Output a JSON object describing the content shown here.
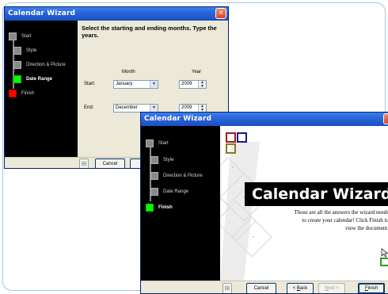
{
  "back_window": {
    "title": "Calendar Wizard",
    "close_icon": "×",
    "nav": [
      {
        "label": "Start"
      },
      {
        "label": "Style"
      },
      {
        "label": "Direction & Picture"
      },
      {
        "label": "Date Range"
      },
      {
        "label": "Finish"
      }
    ],
    "instruction": "Select the starting and ending months.  Type the years.",
    "month_header": "Month",
    "year_header": "Year",
    "start_label": "Start:",
    "start_month": "January",
    "start_year": "2009",
    "end_label": "End:",
    "end_month": "December",
    "end_year": "2009",
    "dropdown_arrow": "▼",
    "buttons": {
      "cancel": "Cancel"
    }
  },
  "front_window": {
    "title": "Calendar Wizard",
    "nav": [
      {
        "label": "Start"
      },
      {
        "label": "Style"
      },
      {
        "label": "Direction & Picture"
      },
      {
        "label": "Date Range"
      },
      {
        "label": "Finish"
      }
    ],
    "heading": "Calendar Wizard",
    "finish_text_line1": "Those are all the answers the wizard needs",
    "finish_text_line2": "to create your calendar!  Click Finish to",
    "finish_text_line3": "view the document.",
    "buttons": {
      "cancel": "Cancel",
      "back_prefix": "< ",
      "back_key": "B",
      "back_rest": "ack",
      "next_key": "N",
      "next_rest": "ext >",
      "finish_key": "F",
      "finish_rest": "inish"
    }
  },
  "colors": {
    "active_step": "#00ff00",
    "finish_step": "#ff0000",
    "titlebar": "#2a66d8",
    "sidebar": "#000000",
    "logo_red": "#a01a1a",
    "logo_navy": "#1a1a80",
    "logo_olive": "#8a7a1a"
  },
  "icons": [
    "close-icon",
    "dropdown-arrow-icon",
    "spinner-icon",
    "help-icon",
    "logo-squares-icon"
  ]
}
